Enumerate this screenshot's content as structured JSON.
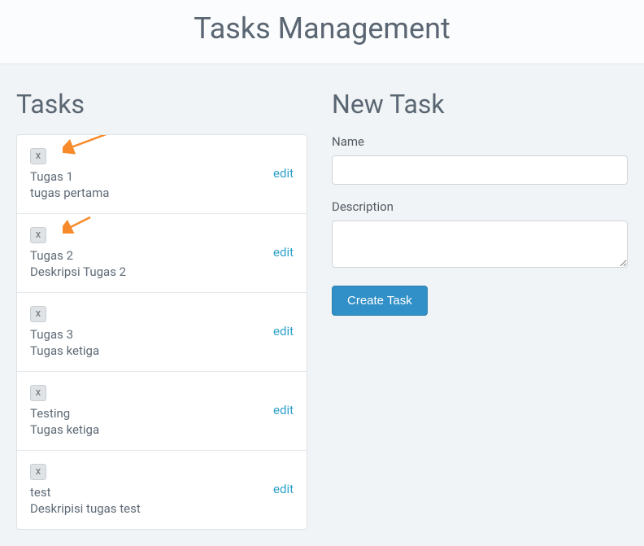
{
  "header": {
    "title": "Tasks Management"
  },
  "tasksSection": {
    "title": "Tasks"
  },
  "tasks": [
    {
      "name": "Tugas 1",
      "description": "tugas pertama",
      "deleteLabel": "x",
      "editLabel": "edit"
    },
    {
      "name": "Tugas 2",
      "description": "Deskripsi Tugas 2",
      "deleteLabel": "x",
      "editLabel": "edit"
    },
    {
      "name": "Tugas 3",
      "description": "Tugas ketiga",
      "deleteLabel": "x",
      "editLabel": "edit"
    },
    {
      "name": "Testing",
      "description": "Tugas ketiga",
      "deleteLabel": "x",
      "editLabel": "edit"
    },
    {
      "name": "test",
      "description": "Deskripisi tugas test",
      "deleteLabel": "x",
      "editLabel": "edit"
    }
  ],
  "newTask": {
    "title": "New Task",
    "nameLabel": "Name",
    "descriptionLabel": "Description",
    "createButton": "Create Task"
  },
  "annotations": {
    "arrowColor": "#f78b2b"
  }
}
